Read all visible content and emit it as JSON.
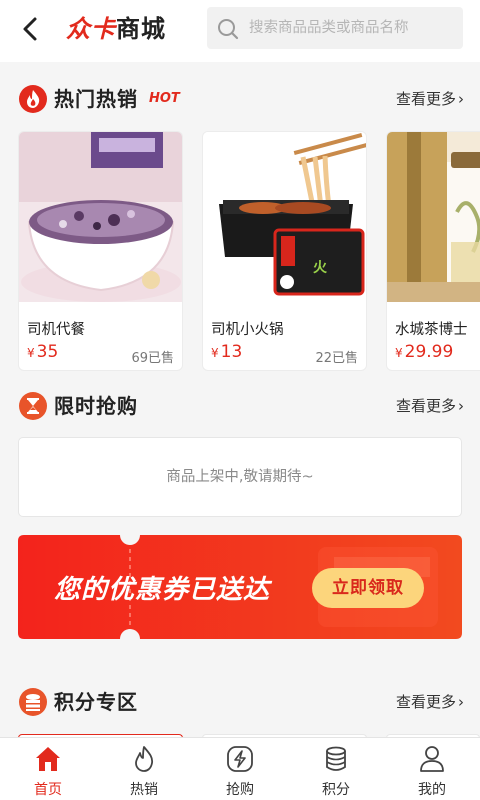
{
  "header": {
    "brand_part1": "众卡",
    "brand_part2": "商城",
    "search_placeholder": "搜索商品品类或商品名称"
  },
  "hot_section": {
    "title": "热门热销",
    "tag": "HOT",
    "more_label": "查看更多",
    "products": [
      {
        "name": "司机代餐",
        "currency": "¥",
        "price": "35",
        "sold": "69已售"
      },
      {
        "name": "司机小火锅",
        "currency": "¥",
        "price": "13",
        "sold": "22已售"
      },
      {
        "name": "水城茶博士",
        "currency": "¥",
        "price": "29.99",
        "sold": ""
      }
    ]
  },
  "flash_section": {
    "title": "限时抢购",
    "more_label": "查看更多",
    "empty_text": "商品上架中,敬请期待~"
  },
  "coupon_banner": {
    "text": "您的优惠券已送达",
    "button_label": "立即领取"
  },
  "points_section": {
    "title": "积分专区",
    "more_label": "查看更多"
  },
  "tabbar": {
    "items": [
      {
        "label": "首页",
        "icon": "home-icon",
        "active": true
      },
      {
        "label": "热销",
        "icon": "flame-icon",
        "active": false
      },
      {
        "label": "抢购",
        "icon": "lightning-icon",
        "active": false
      },
      {
        "label": "积分",
        "icon": "coins-icon",
        "active": false
      },
      {
        "label": "我的",
        "icon": "user-icon",
        "active": false
      }
    ]
  },
  "colors": {
    "accent": "#e22a1d",
    "coupon_button": "#fcd57c"
  }
}
